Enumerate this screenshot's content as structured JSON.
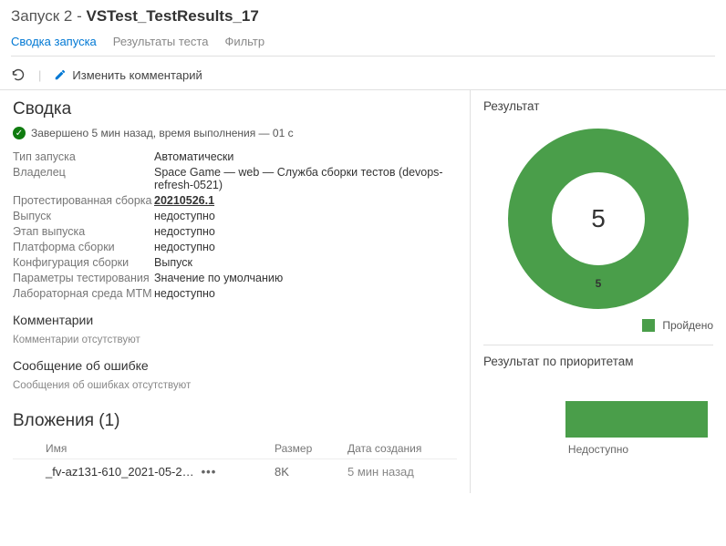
{
  "header": {
    "title_prefix": "Запуск 2 -",
    "title_main": "VSTest_TestResults_17"
  },
  "tabs": {
    "summary": "Сводка запуска",
    "results": "Результаты теста",
    "filter": "Фильтр"
  },
  "toolbar": {
    "edit_comment": "Изменить комментарий"
  },
  "summary": {
    "heading": "Сводка",
    "status": "Завершено 5 мин назад, время выполнения — 01 с",
    "props": {
      "run_type_label": "Тип запуска",
      "run_type_value": "Автоматически",
      "owner_label": "Владелец",
      "owner_value": "Space Game — web — Служба сборки тестов (devops-refresh-0521)",
      "tested_build_label": "Протестированная сборка",
      "tested_build_value": "20210526.1",
      "release_label": "Выпуск",
      "release_value": "недоступно",
      "release_stage_label": "Этап выпуска",
      "release_stage_value": "недоступно",
      "build_platform_label": "Платформа сборки",
      "build_platform_value": "недоступно",
      "build_config_label": "Конфигурация сборки",
      "build_config_value": "Выпуск",
      "test_settings_label": "Параметры тестирования",
      "test_settings_value": "Значение по умолчанию",
      "mtm_env_label": "Лабораторная среда MTM",
      "mtm_env_value": "недоступно"
    },
    "comments_heading": "Комментарии",
    "comments_empty": "Комментарии отсутствуют",
    "error_heading": "Сообщение об ошибке",
    "error_empty": "Сообщения об ошибках отсутствуют"
  },
  "attachments": {
    "heading": "Вложения (1)",
    "col_name": "Имя",
    "col_size": "Размер",
    "col_date": "Дата создания",
    "items": [
      {
        "name": "_fv-az131-610_2021-05-2…",
        "size": "8K",
        "date": "5 мин назад"
      }
    ]
  },
  "result_panel": {
    "title": "Результат",
    "total": "5",
    "donut_label": "5",
    "legend_passed": "Пройдено"
  },
  "priority_panel": {
    "title": "Результат по приоритетам",
    "x_label": "Недоступно"
  },
  "chart_data": [
    {
      "type": "pie",
      "title": "Результат",
      "series": [
        {
          "name": "Пройдено",
          "value": 5
        }
      ],
      "total": 5
    },
    {
      "type": "bar",
      "title": "Результат по приоритетам",
      "categories": [
        "Недоступно"
      ],
      "values": [
        5
      ]
    }
  ]
}
